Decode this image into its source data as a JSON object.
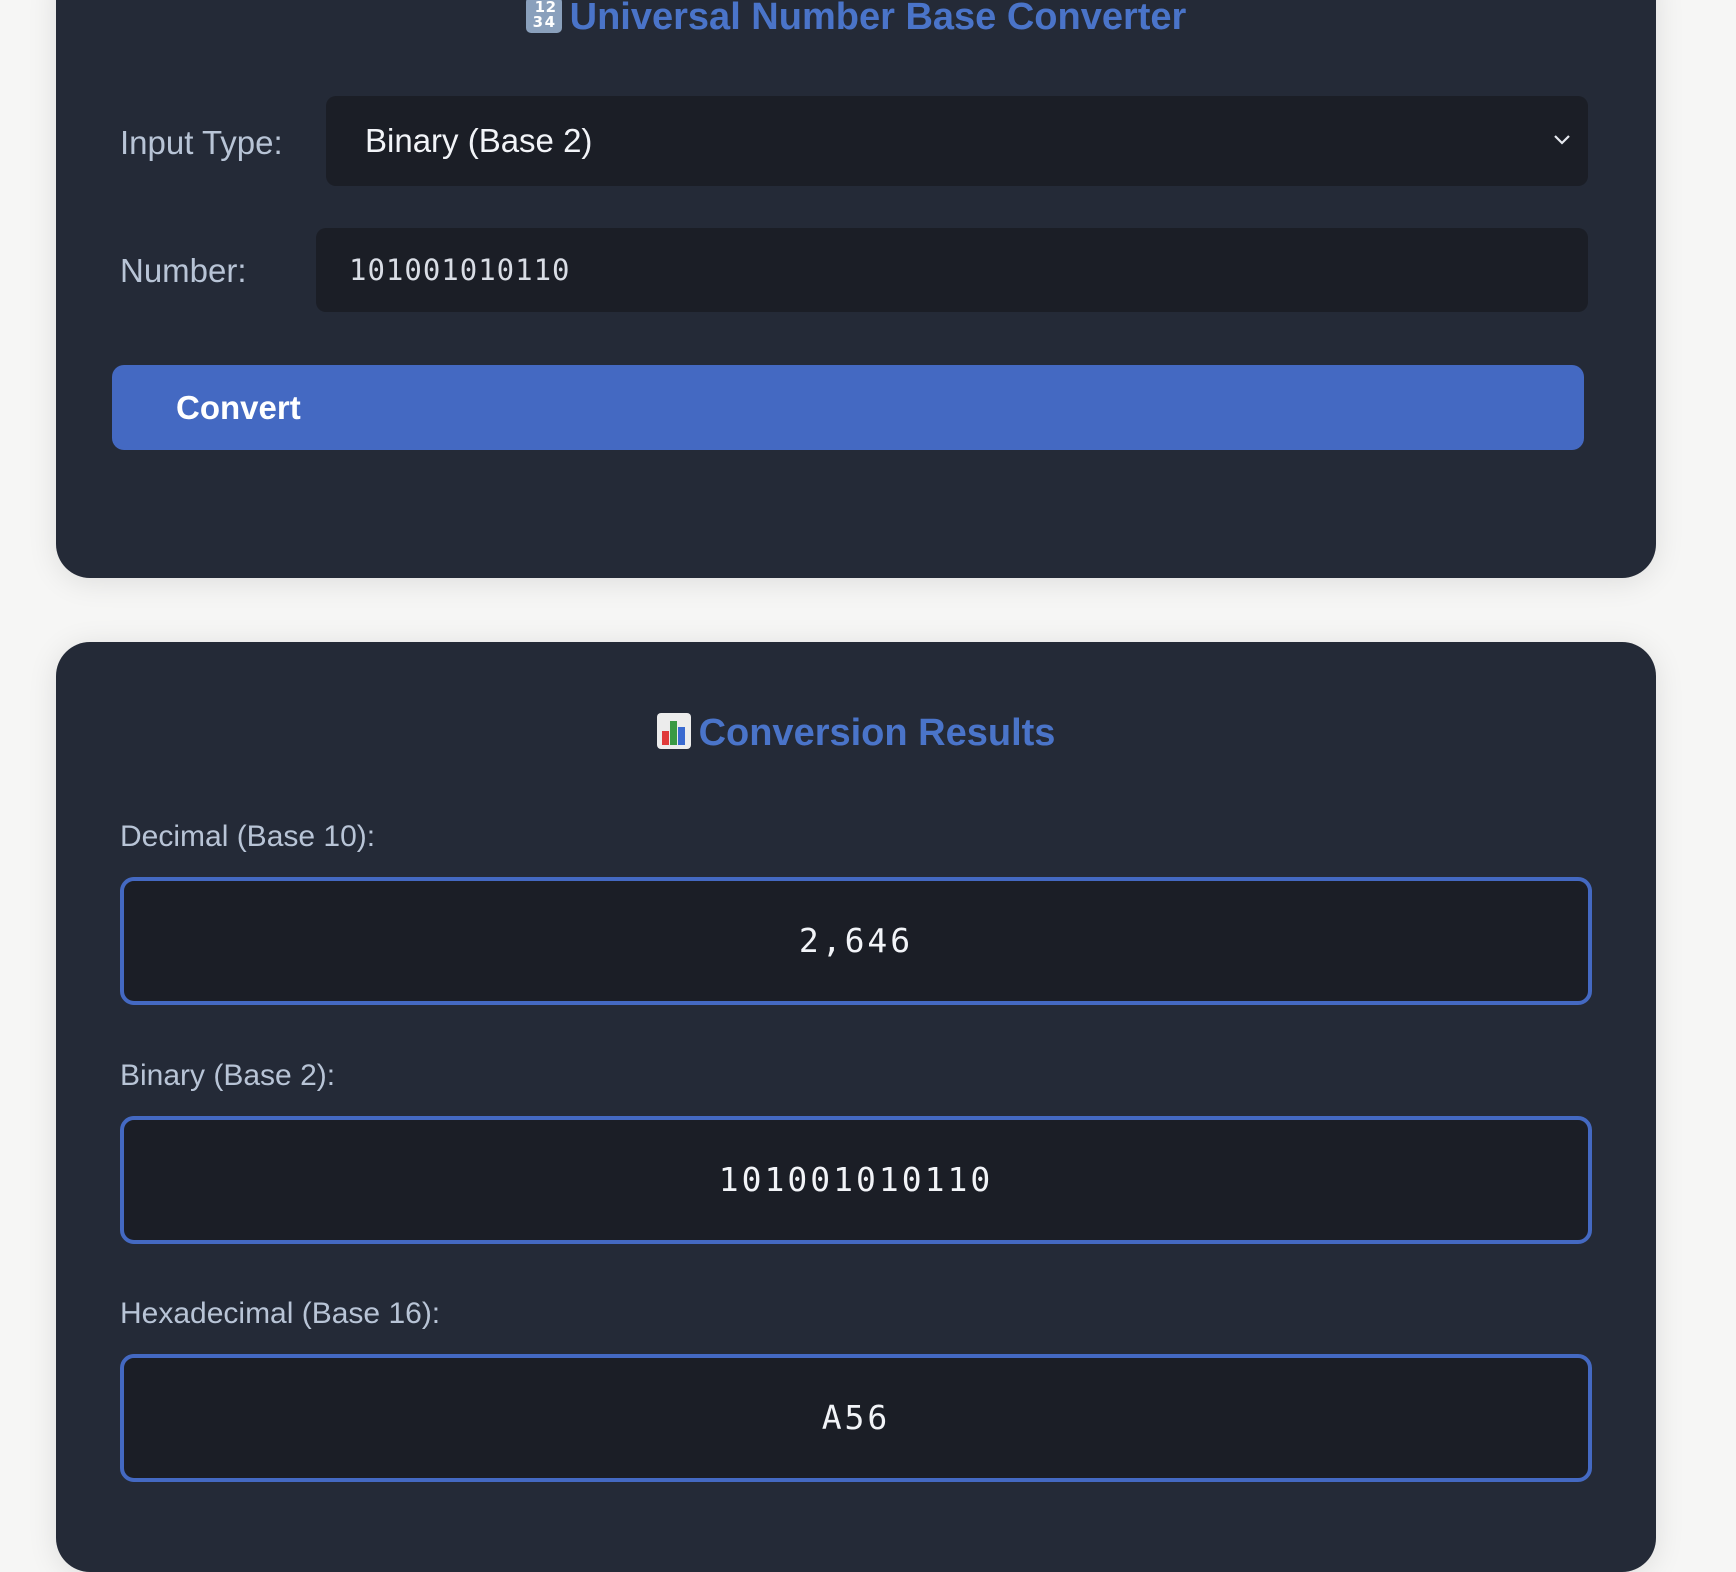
{
  "converter": {
    "title": "Universal Number Base Converter",
    "title_icon": "input-numbers-icon",
    "input_type_label": "Input Type:",
    "input_type_value": "Binary (Base 2)",
    "number_label": "Number:",
    "number_value": "101001010110",
    "convert_label": "Convert"
  },
  "results": {
    "title": "Conversion Results",
    "title_icon": "bar-chart-icon",
    "decimal_label": "Decimal (Base 10):",
    "decimal_value": "2,646",
    "binary_label": "Binary (Base 2):",
    "binary_value": "101001010110",
    "hex_label": "Hexadecimal (Base 16):",
    "hex_value": "A56"
  },
  "colors": {
    "accent": "#4469c2",
    "card_background": "#242a37",
    "field_background": "#1b1e26",
    "page_background": "#f6f6f5"
  }
}
